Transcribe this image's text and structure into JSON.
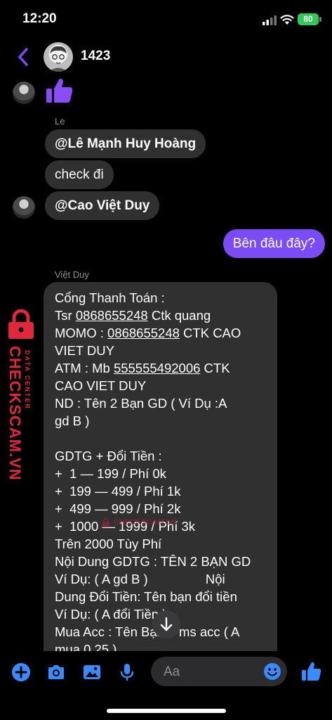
{
  "status_bar": {
    "time": "12:20",
    "battery": "80"
  },
  "header": {
    "contact_name": "1423"
  },
  "messages": {
    "sender_le": "Le",
    "le_1": "@Lê Mạnh Huy Hoàng",
    "le_2": "check đi",
    "le_3": "@Cao Việt Duy",
    "me_1": "Bên đâu đây?",
    "sender_duy": "Việt Duy",
    "duy_lines": {
      "l1": "Cổng Thanh Toán :",
      "l2a": "Tsr ",
      "l2b": "0868655248",
      "l2c": " Ctk quang",
      "l3a": "MOMO : ",
      "l3b": "0868655248",
      "l3c": " CTK CAO",
      "l4": "VIET DUY",
      "l5a": "ATM : Mb ",
      "l5b": "555555492006",
      "l5c": " CTK",
      "l6": "CAO VIET DUY",
      "l7": "ND : Tên 2 Bạn GD ( Ví Dụ :A",
      "l8": "gd B )",
      "l9": "",
      "l10": "GDTG + Đổi Tiền :",
      "l11": "+  1 — 199 / Phí 0k",
      "l12": "+  199 — 499 / Phí 1k",
      "l13": "+  499 — 999 / Phí 2k",
      "l14": "+  1000 — 1999 / Phí 3k",
      "l15": "Trên 2000 Tùy Phí",
      "l16": "Nội Dung GDTG : TÊN 2 BẠN GD",
      "l17": "Ví Dụ: ( A gd B )                Nội",
      "l18": "Dung Đổi Tiền: Tên bạn đổi tiền",
      "l19": "Ví Dụ: ( A đổi Tiền )",
      "l20": "Mua Acc : Tên Bạn + ms acc ( A",
      "l21": "mua 0.25 )"
    }
  },
  "watermark": {
    "brand": "CHECKSCAM.VN",
    "tagline": "DATA CENTER",
    "center": "CHECKSCAM.VN"
  },
  "composer": {
    "placeholder": "Aa"
  },
  "colors": {
    "accent": "#7b4cf5",
    "bubble_in": "#303030",
    "icon_blue": "#3a8bff",
    "watermark": "#e0283d"
  }
}
